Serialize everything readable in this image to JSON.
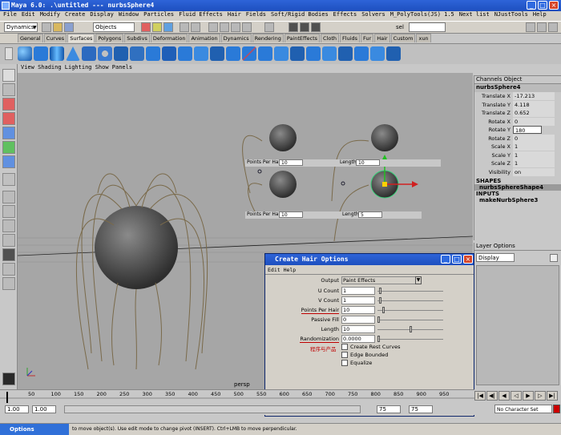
{
  "window": {
    "title": "Maya 6.0: .\\untitled   ---   nurbsSphere4"
  },
  "menubar": {
    "items": [
      "File",
      "Edit",
      "Modify",
      "Create",
      "Display",
      "Window",
      "Particles",
      "Fluid Effects",
      "Hair",
      "Fields",
      "Soft/Rigid Bodies",
      "Effects",
      "Solvers",
      "M_PolyTools(JS) 1.5",
      "Next list",
      "NJustTools",
      "Help"
    ]
  },
  "toolbar": {
    "mode": "Dynamics",
    "select_mode": "Objects",
    "sel_label": "sel"
  },
  "shelf_tabs": {
    "items": [
      "General",
      "Curves",
      "Surfaces",
      "Polygons",
      "Subdivs",
      "Deformation",
      "Animation",
      "Dynamics",
      "Rendering",
      "PaintEffects",
      "Cloth",
      "Fluids",
      "Fur",
      "Hair",
      "Custom",
      "xun"
    ],
    "active": "Surfaces"
  },
  "viewport": {
    "menu": "View  Shading  Lighting  Show  Panels",
    "camera": "persp",
    "overlay_label": "程序与产品"
  },
  "overlays": [
    {
      "pph_label": "Points Per Hair",
      "pph_value": "10",
      "len_label": "Length",
      "len_value": "10"
    },
    {
      "pph_label": "Points Per Hair",
      "pph_value": "10",
      "len_label": "Length",
      "len_value": "5"
    }
  ],
  "channel_box": {
    "header": "Channels  Object",
    "object": "nurbsSphere4",
    "attributes": [
      {
        "label": "Translate X",
        "value": "-17.213"
      },
      {
        "label": "Translate Y",
        "value": "4.118"
      },
      {
        "label": "Translate Z",
        "value": "0.652"
      },
      {
        "label": "Rotate X",
        "value": "0"
      },
      {
        "label": "Rotate Y",
        "value": "180"
      },
      {
        "label": "Rotate Z",
        "value": "0"
      },
      {
        "label": "Scale X",
        "value": "1"
      },
      {
        "label": "Scale Y",
        "value": "1"
      },
      {
        "label": "Scale Z",
        "value": "1"
      },
      {
        "label": "Visibility",
        "value": "on"
      }
    ],
    "shapes_header": "SHAPES",
    "shape": "nurbsSphereShape4",
    "inputs_header": "INPUTS",
    "input": "makeNurbSphere3"
  },
  "layer_editor": {
    "header": "Layer  Options",
    "display": "Display"
  },
  "dialog": {
    "title": "Create Hair Options",
    "menu": "Edit  Help",
    "output_label": "Output",
    "output_value": "Paint Effects",
    "rows": [
      {
        "label": "U Count",
        "value": "1",
        "slider": 0.02
      },
      {
        "label": "V Count",
        "value": "1",
        "slider": 0.02
      },
      {
        "label": "Points Per Hair",
        "value": "10",
        "slider": 0.08
      },
      {
        "label": "Passive Fill",
        "value": "0",
        "slider": 0.0
      },
      {
        "label": "Length",
        "value": "10",
        "slider": 0.5
      },
      {
        "label": "Randomization",
        "value": "0.0000",
        "slider": 0.0
      }
    ],
    "checkboxes": [
      {
        "label": "Create Rest Curves"
      },
      {
        "label": "Edge Bounded"
      },
      {
        "label": "Equalize"
      }
    ],
    "annotation": "程序与产品"
  },
  "timeline": {
    "ticks": [
      "50",
      "100",
      "150",
      "200",
      "250",
      "300",
      "350",
      "400",
      "450",
      "500",
      "550",
      "600",
      "650",
      "700",
      "750",
      "800",
      "850",
      "900",
      "950"
    ],
    "current": "1",
    "start": "1.00",
    "start2": "1.00",
    "end": "75",
    "end2": "75"
  },
  "character": "No Character Set",
  "commandline": {
    "label": "Options",
    "help": "to move object(s). Use edit mode to change pivot (INSERT). Ctrl+LMB to move perpendicular."
  }
}
